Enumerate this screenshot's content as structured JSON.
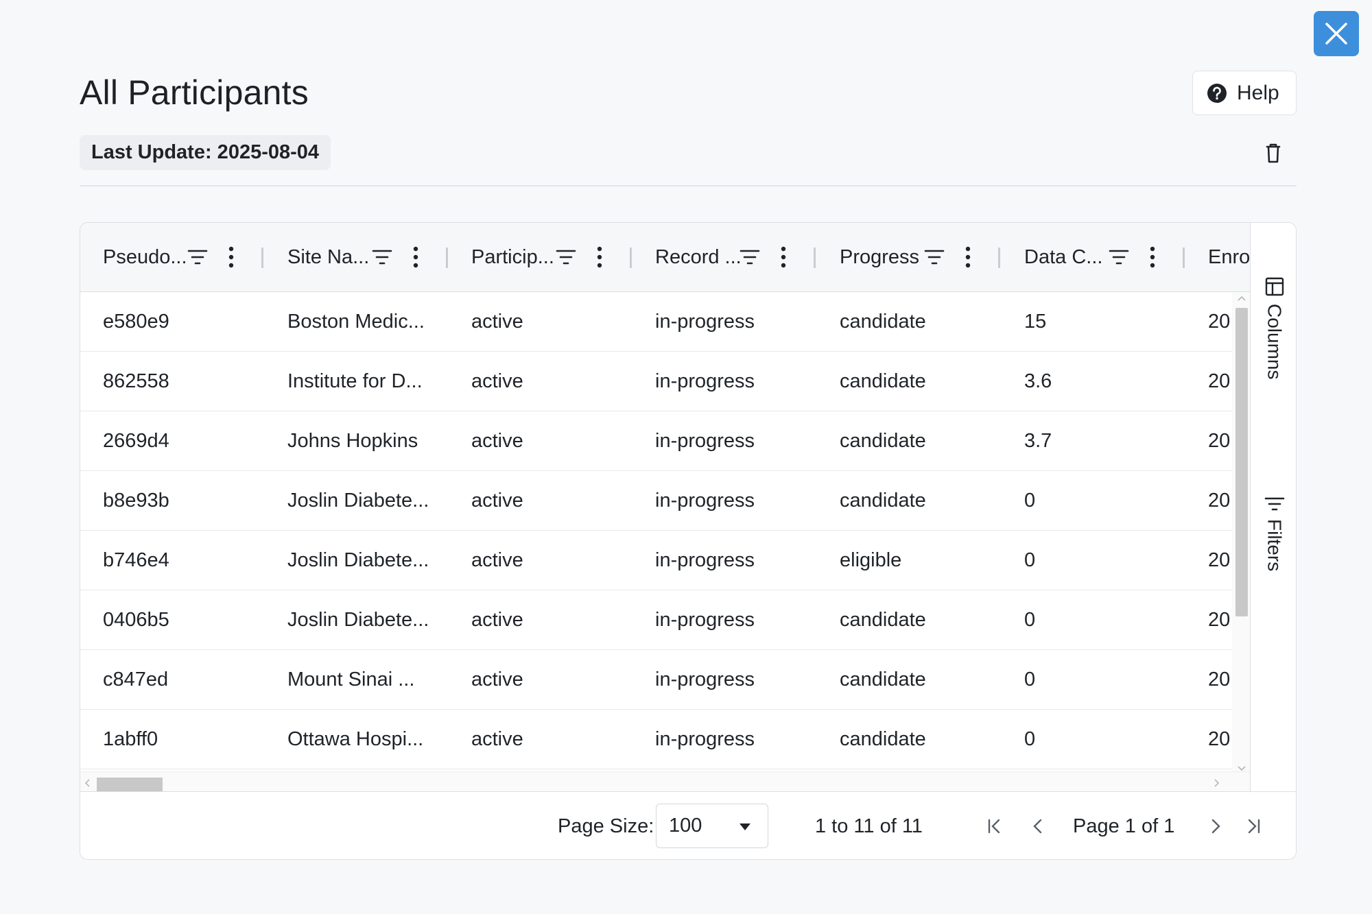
{
  "dialog": {
    "title": "All Participants",
    "last_update": "Last Update: 2025-08-04",
    "help_label": "Help",
    "accent_color": "#3d8fdc"
  },
  "grid": {
    "columns": [
      "Pseudo...",
      "Site Na...",
      "Particip...",
      "Record ...",
      "Progress",
      "Data C...",
      "Enrol"
    ],
    "rows": [
      [
        "e580e9",
        "Boston Medic...",
        "active",
        "in-progress",
        "candidate",
        "15",
        "20"
      ],
      [
        "862558",
        "Institute for D...",
        "active",
        "in-progress",
        "candidate",
        "3.6",
        "20"
      ],
      [
        "2669d4",
        "Johns Hopkins",
        "active",
        "in-progress",
        "candidate",
        "3.7",
        "20"
      ],
      [
        "b8e93b",
        "Joslin Diabete...",
        "active",
        "in-progress",
        "candidate",
        "0",
        "20"
      ],
      [
        "b746e4",
        "Joslin Diabete...",
        "active",
        "in-progress",
        "eligible",
        "0",
        "20"
      ],
      [
        "0406b5",
        "Joslin Diabete...",
        "active",
        "in-progress",
        "candidate",
        "0",
        "20"
      ],
      [
        "c847ed",
        "Mount Sinai ...",
        "active",
        "in-progress",
        "candidate",
        "0",
        "20"
      ],
      [
        "1abff0",
        "Ottawa Hospi...",
        "active",
        "in-progress",
        "candidate",
        "0",
        "20"
      ]
    ],
    "side_tabs": {
      "columns": "Columns",
      "filters": "Filters"
    }
  },
  "pagination": {
    "page_size_label": "Page Size:",
    "page_size_value": "100",
    "range_text": "1 to 11 of 11",
    "page_text": "Page 1 of 1"
  }
}
